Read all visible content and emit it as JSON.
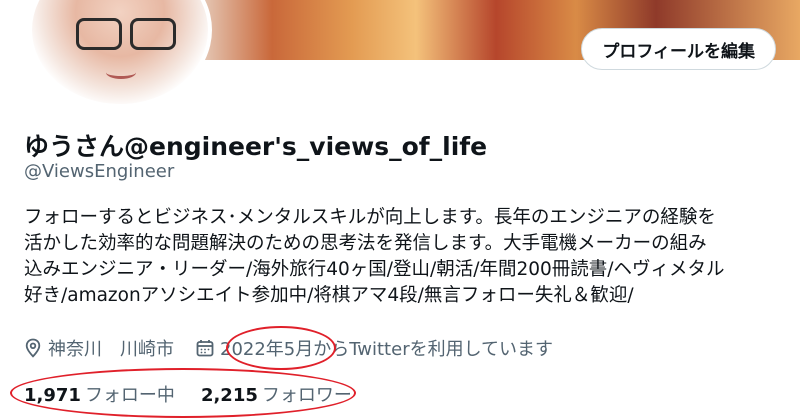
{
  "profile": {
    "edit_button": "プロフィールを編集",
    "display_name": "ゆうさん@engineer's_views_of_life",
    "handle": "@ViewsEngineer",
    "bio_lines": [
      "フォローするとビジネス･メンタルスキルが向上します。長年のエンジニアの経験を",
      "活かした効率的な問題解決のための思考法を発信します。大手電機メーカーの組み",
      "込みエンジニア・リーダー/海外旅行40ヶ国/登山/朝活/年間200冊読書/ヘヴィメタル",
      "好き/amazonアソシエイト参加中/将棋アマ4段/無言フォロー失礼＆歓迎/"
    ],
    "location": "神奈川　川崎市",
    "joined_date": "2022年5月",
    "joined_suffix": "からTwitterを利用しています",
    "following_count": "1,971",
    "following_label": "フォロー中",
    "followers_count": "2,215",
    "followers_label": "フォロワー"
  },
  "icons": {
    "location": "map-pin-icon",
    "calendar": "calendar-icon"
  },
  "colors": {
    "text": "#0f1419",
    "secondary": "#536471",
    "annotation": "#e0202a",
    "border": "#cfd9de"
  }
}
